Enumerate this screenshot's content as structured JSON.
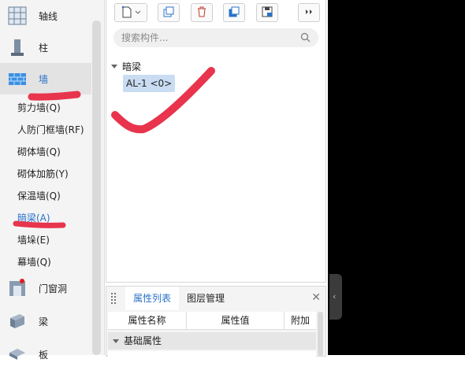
{
  "sidebar": {
    "categories": [
      {
        "label": "轴线",
        "icon": "grid-axis-icon"
      },
      {
        "label": "柱",
        "icon": "column-icon"
      },
      {
        "label": "墙",
        "icon": "wall-icon"
      },
      {
        "label": "门窗洞",
        "icon": "door-window-icon"
      },
      {
        "label": "梁",
        "icon": "beam-icon"
      },
      {
        "label": "板",
        "icon": "slab-icon"
      }
    ],
    "wall_subitems": [
      "剪力墙(Q)",
      "人防门框墙(RF)",
      "砌体墙(Q)",
      "砌体加筋(Y)",
      "保温墙(Q)",
      "暗梁(A)",
      "墙垛(E)",
      "幕墙(Q)"
    ],
    "active_category": "墙",
    "active_subitem": "暗梁(A)"
  },
  "toolbar": {
    "buttons": [
      "new-component-icon",
      "copy-icon",
      "delete-icon",
      "layer-copy-icon",
      "floor-save-icon",
      "more-icon"
    ]
  },
  "search": {
    "placeholder": "搜索构件..."
  },
  "tree": {
    "group": "暗梁",
    "items": [
      {
        "label": "AL-1 <0>"
      }
    ]
  },
  "properties": {
    "tabs": [
      "属性列表",
      "图层管理"
    ],
    "active_tab": "属性列表",
    "columns": [
      "属性名称",
      "属性值",
      "附加"
    ],
    "section": "基础属性"
  },
  "colors": {
    "accent": "#2a72c8",
    "selection": "#c9dcf2",
    "annotation": "#e8344c"
  }
}
